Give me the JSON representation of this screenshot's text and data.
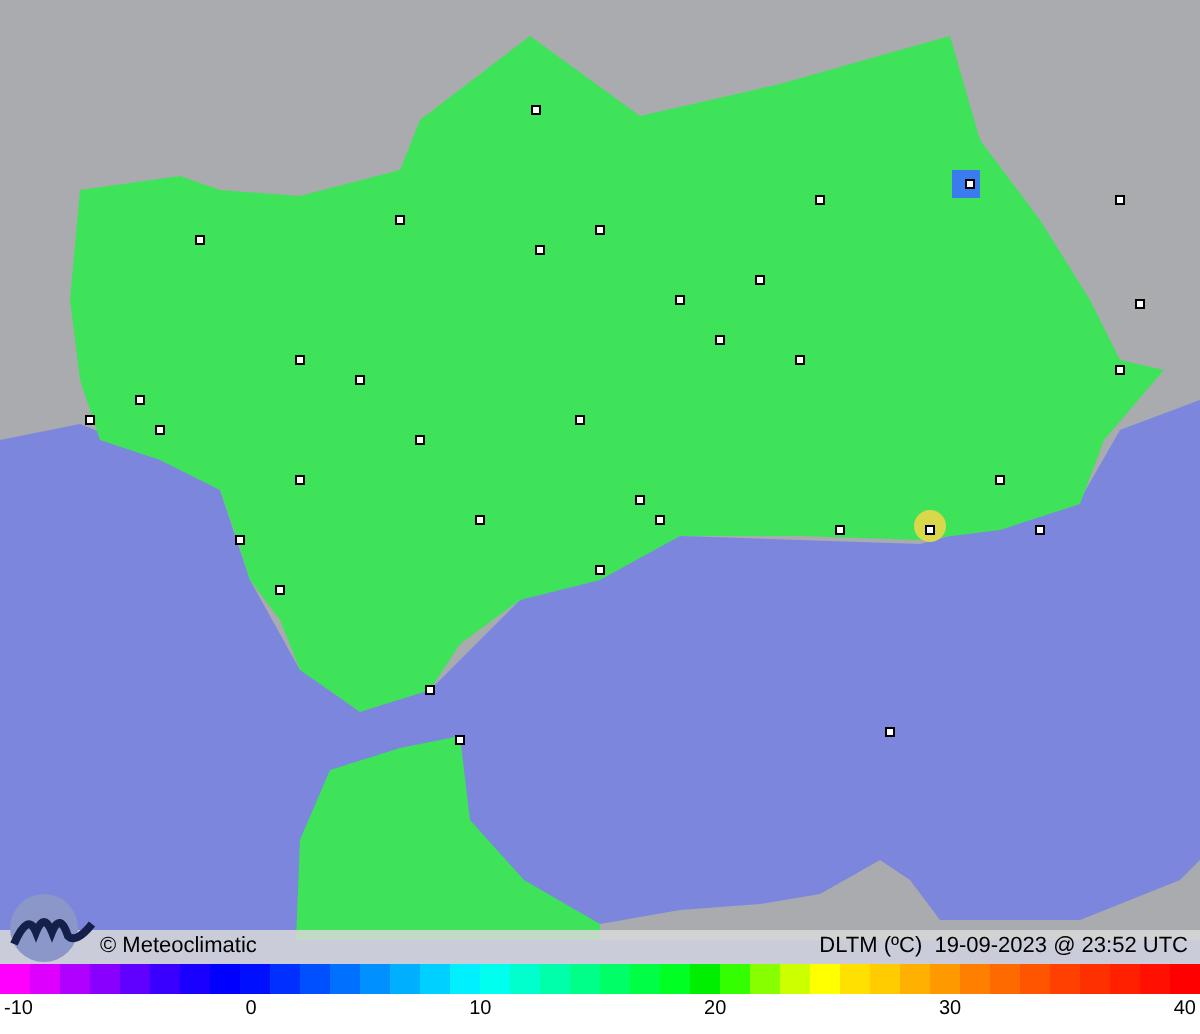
{
  "map": {
    "credit": "© Meteoclimatic",
    "caption": "DLTM (ºC)  19-09-2023 @ 23:52 UTC"
  },
  "legend": {
    "ticks": [
      "-10",
      "0",
      "10",
      "20",
      "30",
      "40"
    ]
  }
}
